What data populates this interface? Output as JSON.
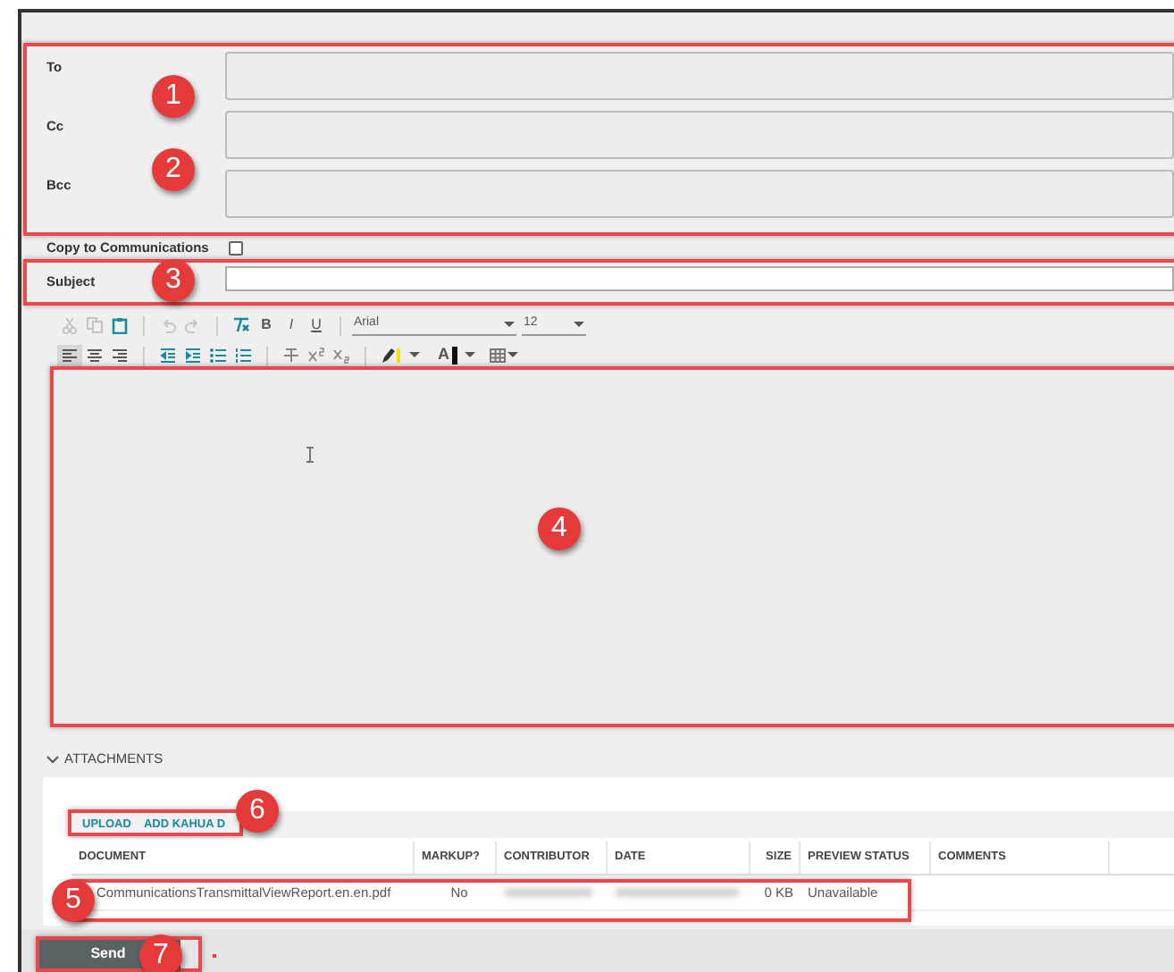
{
  "recipients": [
    {
      "label": "To"
    },
    {
      "label": "Cc"
    },
    {
      "label": "Bcc"
    }
  ],
  "copy_to_communications": {
    "label": "Copy to Communications",
    "checked": false
  },
  "subject": {
    "label": "Subject"
  },
  "editor_toolbar": {
    "clipboard": [
      {
        "disabled": true
      },
      {
        "disabled": true
      },
      {
        "disabled": false
      }
    ],
    "history": [
      {
        "disabled": true
      },
      {
        "disabled": true
      }
    ],
    "format_buttons": [
      {
        "label": "B"
      },
      {
        "label": "I"
      },
      {
        "label": "U"
      }
    ],
    "font": "Arial",
    "size": "12",
    "alignment": [
      {
        "selected": true
      },
      {
        "selected": false
      },
      {
        "selected": false
      }
    ],
    "font_color_label": "A"
  },
  "attachments": {
    "title": "ATTACHMENTS",
    "expanded": true,
    "actions": [
      "UPLOAD",
      "ADD KAHUA D"
    ],
    "columns": [
      "DOCUMENT",
      "MARKUP?",
      "CONTRIBUTOR",
      "DATE",
      "SIZE",
      "PREVIEW STATUS",
      "COMMENTS"
    ],
    "rows": [
      {
        "document": "CommunicationsTransmittalViewReport.en.en.pdf",
        "markup": "No",
        "contributor_redacted": true,
        "date_redacted": true,
        "size": "0 KB",
        "preview_status": "Unavailable"
      }
    ]
  },
  "send_button": {
    "label": "Send"
  },
  "callouts": [
    {
      "number": "1"
    },
    {
      "number": "2"
    },
    {
      "number": "3"
    },
    {
      "number": "4"
    },
    {
      "number": "5"
    },
    {
      "number": "6"
    },
    {
      "number": "7"
    }
  ]
}
